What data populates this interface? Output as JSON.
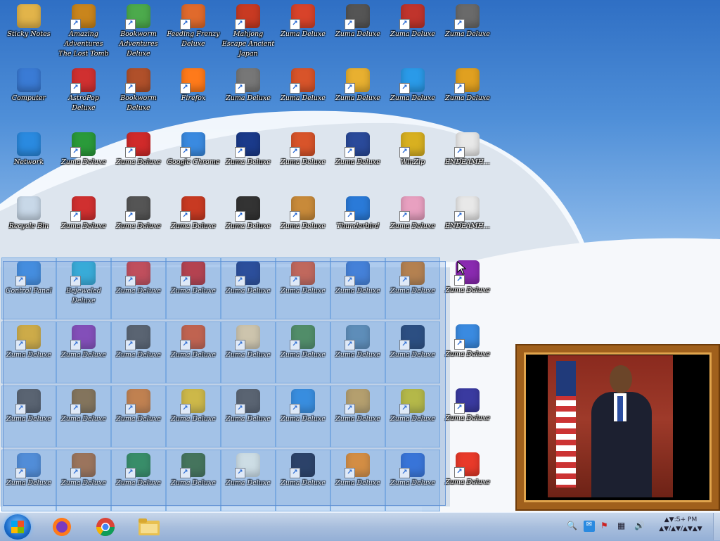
{
  "desktop_icons": [
    {
      "label": "Sticky Notes",
      "icon": "folder-icon",
      "color": "#e2b44a",
      "sel": false
    },
    {
      "label": "Amazing Adventures The Lost Tomb",
      "icon": "game-icon",
      "color": "#c9851c",
      "sel": false
    },
    {
      "label": "Bookworm Adventures Deluxe",
      "icon": "game-icon",
      "color": "#4caa4c",
      "sel": false
    },
    {
      "label": "Feeding Frenzy Deluxe",
      "icon": "game-icon",
      "color": "#e06a2c",
      "sel": false
    },
    {
      "label": "Mahjong Escape Ancient Japan",
      "icon": "game-icon",
      "color": "#c83a22",
      "sel": false
    },
    {
      "label": "Zuma Deluxe",
      "icon": "game-icon",
      "color": "#d8432a",
      "sel": false
    },
    {
      "label": "Zuma Deluxe",
      "icon": "game-icon",
      "color": "#555555",
      "sel": false
    },
    {
      "label": "Zuma Deluxe",
      "icon": "game-icon",
      "color": "#c0342c",
      "sel": false
    },
    {
      "label": "Zuma Deluxe",
      "icon": "game-icon",
      "color": "#6a6a6a",
      "sel": false
    },
    {
      "label": "Computer",
      "icon": "computer-icon",
      "color": "#3a7bd5",
      "sel": false
    },
    {
      "label": "AstroPop Deluxe",
      "icon": "game-icon",
      "color": "#d03030",
      "sel": false
    },
    {
      "label": "Bookworm Deluxe",
      "icon": "game-icon",
      "color": "#b0502a",
      "sel": false
    },
    {
      "label": "Firefox",
      "icon": "firefox-icon",
      "color": "#ff7a1a",
      "sel": false
    },
    {
      "label": "Zuma Deluxe",
      "icon": "game-icon",
      "color": "#777777",
      "sel": false
    },
    {
      "label": "Zuma Deluxe",
      "icon": "game-icon",
      "color": "#d8542a",
      "sel": false
    },
    {
      "label": "Zuma Deluxe",
      "icon": "game-icon",
      "color": "#e8b030",
      "sel": false
    },
    {
      "label": "Zuma Deluxe",
      "icon": "browser-icon",
      "color": "#2a9ae8",
      "sel": false
    },
    {
      "label": "Zuma Deluxe",
      "icon": "game-icon",
      "color": "#e0a020",
      "sel": false
    },
    {
      "label": "Network",
      "icon": "network-icon",
      "color": "#2a8ae0",
      "sel": false
    },
    {
      "label": "Zuma Deluxe",
      "icon": "game-icon",
      "color": "#2a9a3a",
      "sel": false
    },
    {
      "label": "Zuma Deluxe",
      "icon": "game-icon",
      "color": "#d02a2a",
      "sel": false
    },
    {
      "label": "Google Chrome",
      "icon": "chrome-icon",
      "color": "#3a8ae0",
      "sel": false
    },
    {
      "label": "Zuma Deluxe",
      "icon": "game-icon",
      "color": "#1a3a8a",
      "sel": false
    },
    {
      "label": "Zuma Deluxe",
      "icon": "game-icon",
      "color": "#d8542a",
      "sel": false
    },
    {
      "label": "Zuma Deluxe",
      "icon": "game-icon",
      "color": "#2a4a9a",
      "sel": false
    },
    {
      "label": "WinZip",
      "icon": "archive-icon",
      "color": "#d8b020",
      "sel": false
    },
    {
      "label": "ENDEAMH...",
      "icon": "document-icon",
      "color": "#e8e8e8",
      "sel": false
    },
    {
      "label": "Recycle Bin",
      "icon": "recycle-bin-icon",
      "color": "#c8d8e8",
      "sel": false
    },
    {
      "label": "Zuma Deluxe",
      "icon": "game-icon",
      "color": "#d03030",
      "sel": false
    },
    {
      "label": "Zuma Deluxe",
      "icon": "game-icon",
      "color": "#555555",
      "sel": false
    },
    {
      "label": "Zuma Deluxe",
      "icon": "game-icon",
      "color": "#c83a22",
      "sel": false
    },
    {
      "label": "Zuma Deluxe",
      "icon": "game-icon",
      "color": "#333333",
      "sel": false
    },
    {
      "label": "Zuma Deluxe",
      "icon": "game-icon",
      "color": "#c88a3a",
      "sel": false
    },
    {
      "label": "Thunderbird",
      "icon": "mail-icon",
      "color": "#2a7ad8",
      "sel": false
    },
    {
      "label": "Zuma Deluxe",
      "icon": "game-icon",
      "color": "#e8a0c0",
      "sel": false
    },
    {
      "label": "ENDEAMH...",
      "icon": "document-icon",
      "color": "#e8e8e8",
      "sel": false
    },
    {
      "label": "Control Panel",
      "icon": "control-panel-icon",
      "color": "#3a8ae0",
      "sel": true
    },
    {
      "label": "Bejeweled Deluxe",
      "icon": "game-icon",
      "color": "#2ab0d8",
      "sel": true
    },
    {
      "label": "Zuma Deluxe",
      "icon": "game-icon",
      "color": "#d83a3a",
      "sel": true
    },
    {
      "label": "Zuma Deluxe",
      "icon": "game-icon",
      "color": "#c82a2a",
      "sel": true
    },
    {
      "label": "Zuma Deluxe",
      "icon": "game-icon",
      "color": "#1a3a8a",
      "sel": true
    },
    {
      "label": "Zuma Deluxe",
      "icon": "game-icon",
      "color": "#d85a3a",
      "sel": true
    },
    {
      "label": "Zuma Deluxe",
      "icon": "game-icon",
      "color": "#3a7ad8",
      "sel": true
    },
    {
      "label": "Zuma Deluxe",
      "icon": "game-icon",
      "color": "#c87a2a",
      "sel": true
    },
    {
      "label": "Zuma Deluxe",
      "icon": "game-icon",
      "color": "#8a2ab0",
      "sel": false
    },
    {
      "label": "Zuma Deluxe",
      "icon": "game-icon",
      "color": "#e8b020",
      "sel": true
    },
    {
      "label": "Zuma Deluxe",
      "icon": "game-icon",
      "color": "#8a3ab0",
      "sel": true
    },
    {
      "label": "Zuma Deluxe",
      "icon": "game-icon",
      "color": "#555555",
      "sel": true
    },
    {
      "label": "Zuma Deluxe",
      "icon": "game-icon",
      "color": "#d8542a",
      "sel": true
    },
    {
      "label": "Zuma Deluxe",
      "icon": "game-icon",
      "color": "#e8d0a0",
      "sel": true
    },
    {
      "label": "Zuma Deluxe",
      "icon": "game-icon",
      "color": "#4a8a4a",
      "sel": true
    },
    {
      "label": "Zuma Deluxe",
      "icon": "game-icon",
      "color": "#5a8ab0",
      "sel": true
    },
    {
      "label": "Zuma Deluxe",
      "icon": "game-icon",
      "color": "#1a3a6a",
      "sel": true
    },
    {
      "label": "Zuma Deluxe",
      "icon": "photo-icon",
      "color": "#3a8ae0",
      "sel": false
    },
    {
      "label": "Zuma Deluxe",
      "icon": "game-icon",
      "color": "#555555",
      "sel": true
    },
    {
      "label": "Zuma Deluxe",
      "icon": "game-icon",
      "color": "#8a6a3a",
      "sel": true
    },
    {
      "label": "Zuma Deluxe",
      "icon": "game-icon",
      "color": "#d87a2a",
      "sel": true
    },
    {
      "label": "Zuma Deluxe",
      "icon": "game-icon",
      "color": "#e8c020",
      "sel": true
    },
    {
      "label": "Zuma Deluxe",
      "icon": "game-icon",
      "color": "#555555",
      "sel": true
    },
    {
      "label": "Zuma Deluxe",
      "icon": "help-icon",
      "color": "#2a8ae0",
      "sel": true
    },
    {
      "label": "Zuma Deluxe",
      "icon": "game-icon",
      "color": "#c8a050",
      "sel": true
    },
    {
      "label": "Zuma Deluxe",
      "icon": "game-icon",
      "color": "#c8c020",
      "sel": true
    },
    {
      "label": "Zuma Deluxe",
      "icon": "game-icon",
      "color": "#3a3aa0",
      "sel": false
    },
    {
      "label": "Zuma Deluxe",
      "icon": "game-icon",
      "color": "#4a8ad8",
      "sel": true
    },
    {
      "label": "Zuma Deluxe",
      "icon": "game-icon",
      "color": "#a86a3a",
      "sel": true
    },
    {
      "label": "Zuma Deluxe",
      "icon": "game-icon",
      "color": "#2a8a4a",
      "sel": true
    },
    {
      "label": "Zuma Deluxe",
      "icon": "game-icon",
      "color": "#3a6a3a",
      "sel": true
    },
    {
      "label": "Zuma Deluxe",
      "icon": "notepad-icon",
      "color": "#e8f0e8",
      "sel": true
    },
    {
      "label": "Zuma Deluxe",
      "icon": "game-icon",
      "color": "#1a2a4a",
      "sel": true
    },
    {
      "label": "Zuma Deluxe",
      "icon": "vlc-icon",
      "color": "#f08a1a",
      "sel": true
    },
    {
      "label": "Zuma Deluxe",
      "icon": "game-icon",
      "color": "#2a6ad8",
      "sel": true
    },
    {
      "label": "Zuma Deluxe",
      "icon": "game-icon",
      "color": "#e83a2a",
      "sel": false
    }
  ],
  "taskbar": {
    "start_label": "Start",
    "pinned": [
      {
        "name": "firefox",
        "label": "Firefox",
        "color": "#ff7a1a"
      },
      {
        "name": "chrome",
        "label": "Google Chrome",
        "color": "#3a8ae0"
      },
      {
        "name": "explorer",
        "label": "File Explorer",
        "color": "#e8c050"
      }
    ],
    "clock_time": "▲▼:Ƽ+ PM",
    "clock_date": "▲▼/▲▼/▲▼▲▼"
  },
  "colors": {
    "taskbar": "#a8bedd",
    "selection": "#6e9bdc",
    "frame": "#a0601c"
  }
}
